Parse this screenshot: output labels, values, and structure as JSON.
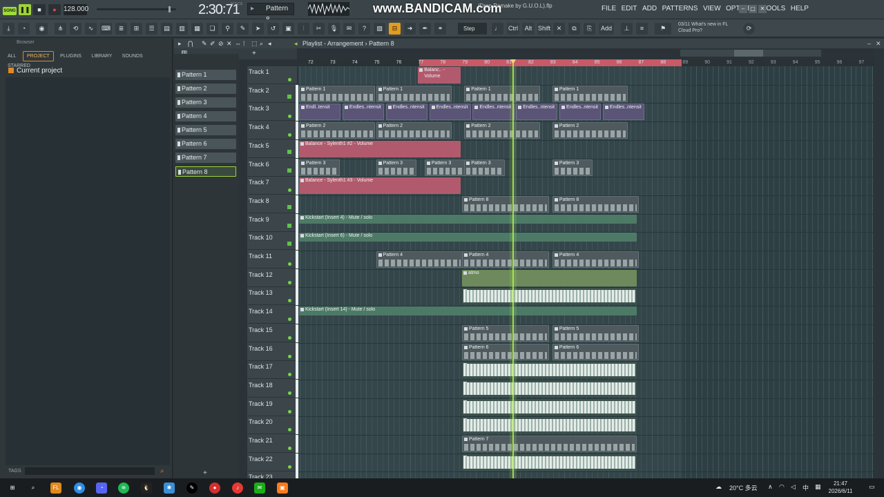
{
  "topbar": {
    "song_badge": "SONG",
    "tempo": "128.000",
    "time": "2:30:71",
    "time_units": "M:S:CS",
    "pattern_selector": "Pattern 8",
    "recorder_watermark": "www.BANDICAM.com",
    "project_file": "(Drop Remake by G.U.O.L).flp",
    "menu": [
      "FILE",
      "EDIT",
      "ADD",
      "PATTERNS",
      "VIEW",
      "OPTIONS",
      "TOOLS",
      "HELP"
    ]
  },
  "toolbar": {
    "snap_label": "Step",
    "keys": [
      "Ctrl",
      "Alt",
      "Shift"
    ],
    "add_label": "Add",
    "news_date": "03/11",
    "news_text": "What's new in FL Cloud Pro?"
  },
  "browser": {
    "header": "Browser",
    "tabs": [
      "ALL",
      "PROJECT",
      "PLUGINS",
      "LIBRARY",
      "SOUNDS",
      "STARRED"
    ],
    "selected_tab": "PROJECT",
    "current": "Current project",
    "tags_label": "TAGS"
  },
  "playlist": {
    "title": "Playlist - Arrangement",
    "separator": "›",
    "pattern": "Pattern 8"
  },
  "patterns": [
    "Pattern 1",
    "Pattern 2",
    "Pattern 3",
    "Pattern 4",
    "Pattern 5",
    "Pattern 6",
    "Pattern 7",
    "Pattern 8"
  ],
  "selected_pattern": 8,
  "timeline_ticks": [
    "72",
    "73",
    "74",
    "75",
    "76",
    "77",
    "78",
    "79",
    "80",
    "81",
    "82",
    "83",
    "84",
    "85",
    "86",
    "87",
    "88",
    "89",
    "90",
    "91",
    "92",
    "93",
    "94",
    "95",
    "96",
    "97"
  ],
  "tracks": [
    "Track 1",
    "Track 2",
    "Track 3",
    "Track 4",
    "Track 5",
    "Track 6",
    "Track 7",
    "Track 8",
    "Track 9",
    "Track 10",
    "Track 11",
    "Track 12",
    "Track 13",
    "Track 14",
    "Track 15",
    "Track 16",
    "Track 17",
    "Track 18",
    "Track 19",
    "Track 20",
    "Track 21",
    "Track 22",
    "Track 23"
  ],
  "clip_labels": {
    "balance_short": "Balanc.. - Volume",
    "balance_2": "Balance - Sylenth1 #2 - Volume",
    "balance_3": "Balance - Sylenth1 #3 - Volume",
    "endless_first": "Endl..tensit",
    "endless": "Endles..ntensit",
    "kick4": "Kickstart (Insert 4) - Mute / solo",
    "kick6": "Kickstart (Insert 6) - Mute / solo",
    "kick14": "Kickstart (Insert 14) - Mute / solo",
    "atmo": "atmo",
    "p1": "Pattern 1",
    "p2": "Pattern 2",
    "p3": "Pattern 3",
    "p4": "Pattern 4",
    "p5": "Pattern 5",
    "p6": "Pattern 6",
    "p7": "Pattern 7",
    "p8": "Pattern 8"
  },
  "taskbar": {
    "weather": "20°C 多云",
    "ime": "中",
    "time": "21:47",
    "date": "2026/6/11"
  },
  "colors": {
    "accent_orange": "#e08a1f",
    "playhead": "#b6ec55",
    "loop_region": "#c75a66"
  }
}
